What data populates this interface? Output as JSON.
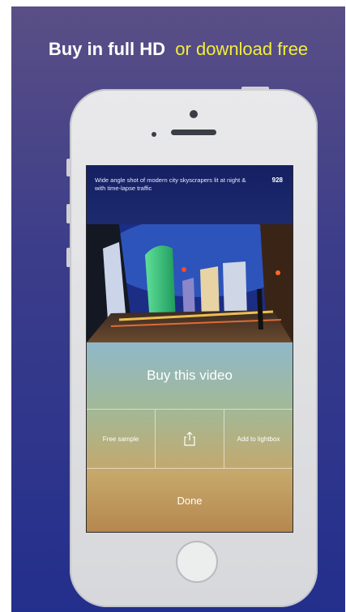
{
  "headline": {
    "part1": "Buy in full HD",
    "part2": "or download free"
  },
  "video": {
    "caption": "Wide angle shot of modern city skyscrapers lit at night & with time-lapse traffic",
    "count": "928"
  },
  "actions": {
    "buy_label": "Buy this video",
    "free_sample_label": "Free sample",
    "share_icon": "share-icon",
    "lightbox_label": "Add to lightbox",
    "done_label": "Done"
  },
  "colors": {
    "headline_white": "#ffffff",
    "headline_yellow": "#f3ee3a",
    "background_top": "#5a4f86",
    "background_bottom": "#232f8c"
  }
}
